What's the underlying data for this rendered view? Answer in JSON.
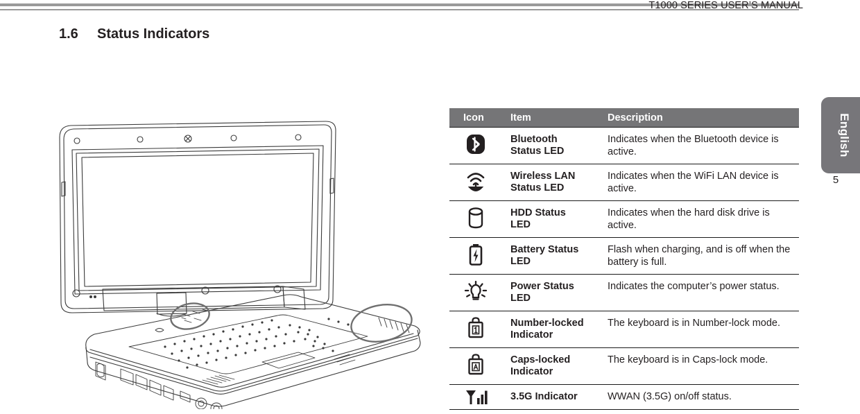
{
  "header": {
    "manual_title": "T1000 SERIES USER’S MANUAL",
    "rule_color": "#9a9a9a"
  },
  "section": {
    "number": "1.6",
    "title": "Status Indicators"
  },
  "sidebar": {
    "language_tab_label": "English",
    "tab_color": "#77767a",
    "page_number": "5"
  },
  "illustration": {
    "name": "convertible-tablet-laptop-line-drawing",
    "callouts": [
      "left-indicator-area-callout",
      "right-indicator-area-callout"
    ]
  },
  "table": {
    "header_bg": "#757577",
    "columns": [
      "Icon",
      "Item",
      "Description"
    ],
    "rows": [
      {
        "icon": "bluetooth-icon",
        "item": "Bluetooth Status LED",
        "item_line1": "Bluetooth",
        "item_line2": "Status LED",
        "description": "Indicates when the Bluetooth device is active."
      },
      {
        "icon": "wireless-lan-icon",
        "item": "Wireless LAN Status LED",
        "item_line1": "Wireless LAN",
        "item_line2": "Status LED",
        "description": "Indicates when the WiFi LAN device is active."
      },
      {
        "icon": "hdd-icon",
        "item": "HDD Status LED",
        "item_line1": "HDD Status",
        "item_line2": "LED",
        "description": "Indicates when the hard disk drive is active."
      },
      {
        "icon": "battery-charging-icon",
        "item": "Battery Status LED",
        "item_line1": "Battery Status",
        "item_line2": "LED",
        "description": "Flash when charging, and is off when the battery is full."
      },
      {
        "icon": "power-lightbulb-icon",
        "item": "Power Status LED",
        "item_line1": "Power Status",
        "item_line2": "LED",
        "description": "Indicates the computer’s power status."
      },
      {
        "icon": "number-lock-icon",
        "item": "Number-locked Indicator",
        "item_line1": "Number-locked",
        "item_line2": "Indicator",
        "description": "The keyboard is in Number-lock mode."
      },
      {
        "icon": "caps-lock-icon",
        "item": "Caps-locked Indicator",
        "item_line1": "Caps-locked",
        "item_line2": "Indicator",
        "description": "The keyboard is in Caps-lock mode."
      },
      {
        "icon": "signal-bars-icon",
        "item": "3.5G Indicator",
        "item_line1": "3.5G Indicator",
        "item_line2": "",
        "description": "WWAN (3.5G) on/off status."
      }
    ]
  }
}
